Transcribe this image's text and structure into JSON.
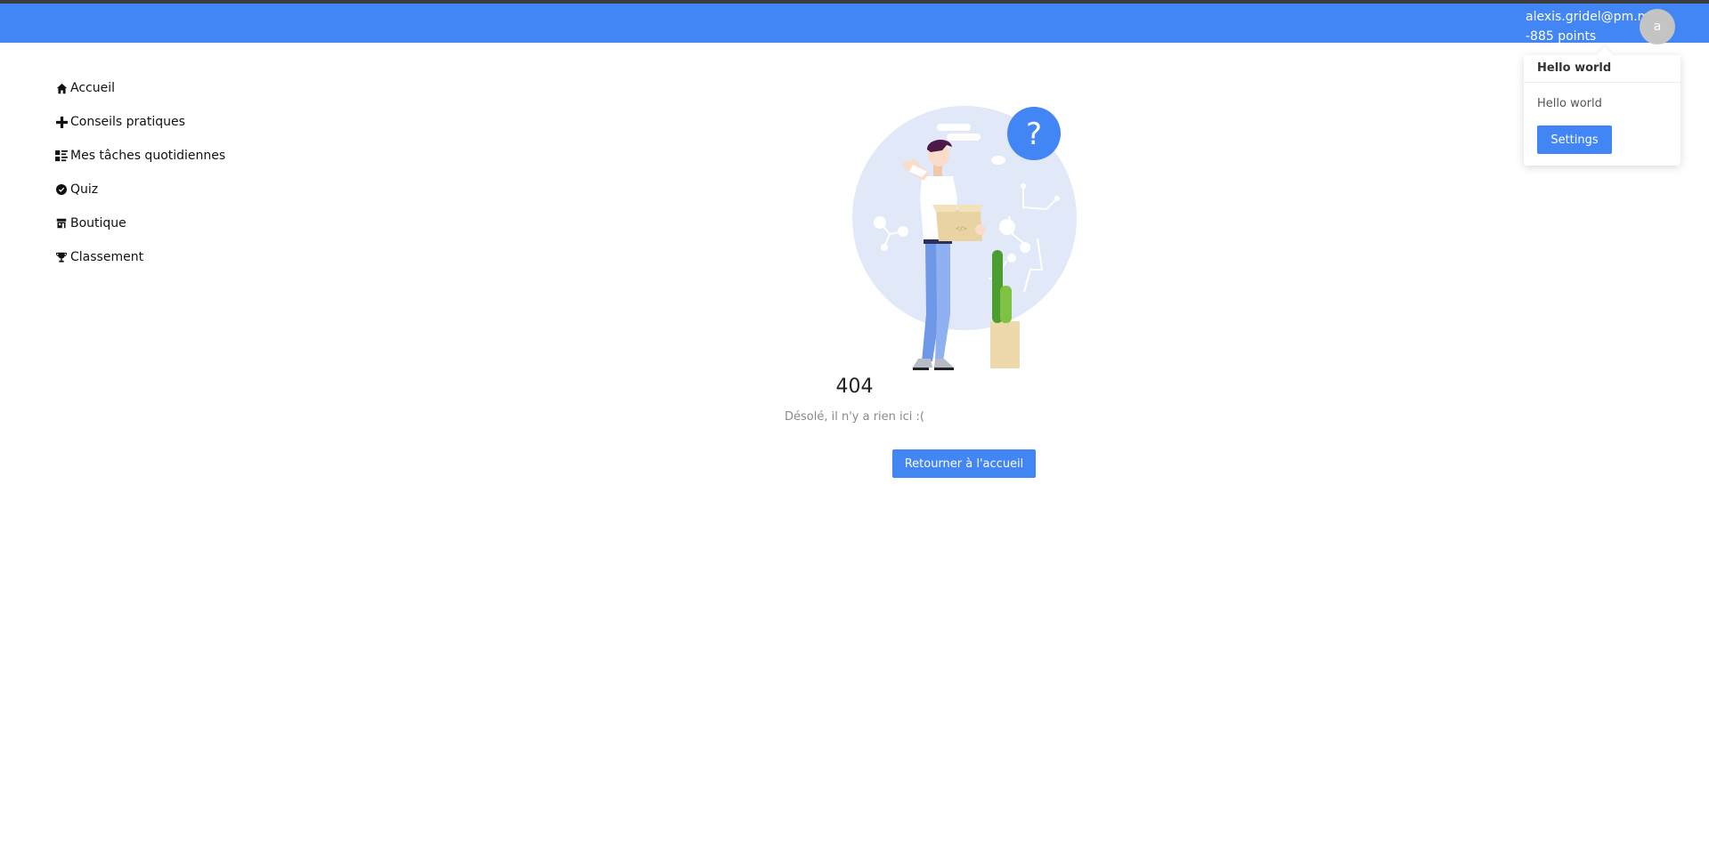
{
  "user": {
    "email": "alexis.gridel@pm.me",
    "points": "-885 points",
    "avatar_initial": "a"
  },
  "popover": {
    "title": "Hello world",
    "body": "Hello world",
    "settings_label": "Settings"
  },
  "sidebar": {
    "items": [
      {
        "label": "Accueil",
        "icon": "home-icon"
      },
      {
        "label": "Conseils pratiques",
        "icon": "plus-icon"
      },
      {
        "label": "Mes tâches quotidiennes",
        "icon": "tasks-icon"
      },
      {
        "label": "Quiz",
        "icon": "check-circle-icon"
      },
      {
        "label": "Boutique",
        "icon": "store-icon"
      },
      {
        "label": "Classement",
        "icon": "trophy-icon"
      }
    ]
  },
  "main": {
    "error_code": "404",
    "message": "Désolé, il n'y a rien ici :(",
    "home_button_label": "Retourner à l'accueil"
  },
  "colors": {
    "primary": "#4285f4",
    "header_background": "#4285f4",
    "avatar_background": "#c4c4c4"
  }
}
